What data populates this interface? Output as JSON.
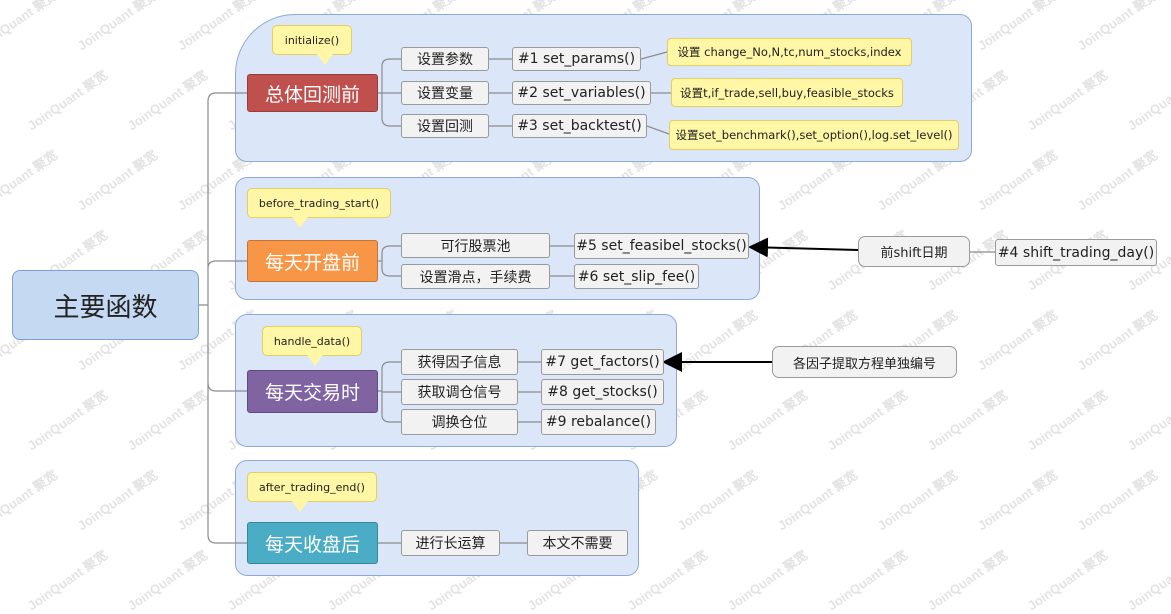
{
  "colors": {
    "group_fill": "#dbe6f8",
    "group_border": "#8ea9d6",
    "line": "#8c8c8c",
    "arrow": "#000000",
    "main_red": "#c0504d",
    "main_orange": "#f79646",
    "main_purple": "#8064a2",
    "main_teal": "#4bacc6",
    "note_yellow": "#fff6a6",
    "root_blue": "#c6d9f3"
  },
  "watermark": "JoinQuant 聚宽",
  "root": {
    "label": "主要函数"
  },
  "groups": [
    {
      "callout": "initialize()",
      "main": "总体回测前",
      "items": [
        {
          "label": "设置参数",
          "func": "#1  set_params()",
          "note": "设置 change_No,N,tc,num_stocks,index"
        },
        {
          "label": "设置变量",
          "func": "#2  set_variables()",
          "note": "设置t,if_trade,sell,buy,feasible_stocks"
        },
        {
          "label": "设置回测",
          "func": "#3  set_backtest()",
          "note": "设置set_benchmark(),set_option(),log.set_level()"
        }
      ]
    },
    {
      "callout": "before_trading_start()",
      "main": "每天开盘前",
      "items": [
        {
          "label": "可行股票池",
          "func": "#5 set_feasibel_stocks()"
        },
        {
          "label": "设置滑点，手续费",
          "func": "#6 set_slip_fee()"
        }
      ],
      "external": {
        "label": "前shift日期",
        "func": "#4 shift_trading_day()"
      }
    },
    {
      "callout": "handle_data()",
      "main": "每天交易时",
      "items": [
        {
          "label": "获得因子信息",
          "func": "#7 get_factors()"
        },
        {
          "label": "获取调仓信号",
          "func": "#8  get_stocks()"
        },
        {
          "label": "调换仓位",
          "func": "#9  rebalance()"
        }
      ],
      "external": {
        "label": "各因子提取方程单独编号"
      }
    },
    {
      "callout": "after_trading_end()",
      "main": "每天收盘后",
      "items": [
        {
          "label": "进行长运算",
          "func": "本文不需要"
        }
      ]
    }
  ]
}
